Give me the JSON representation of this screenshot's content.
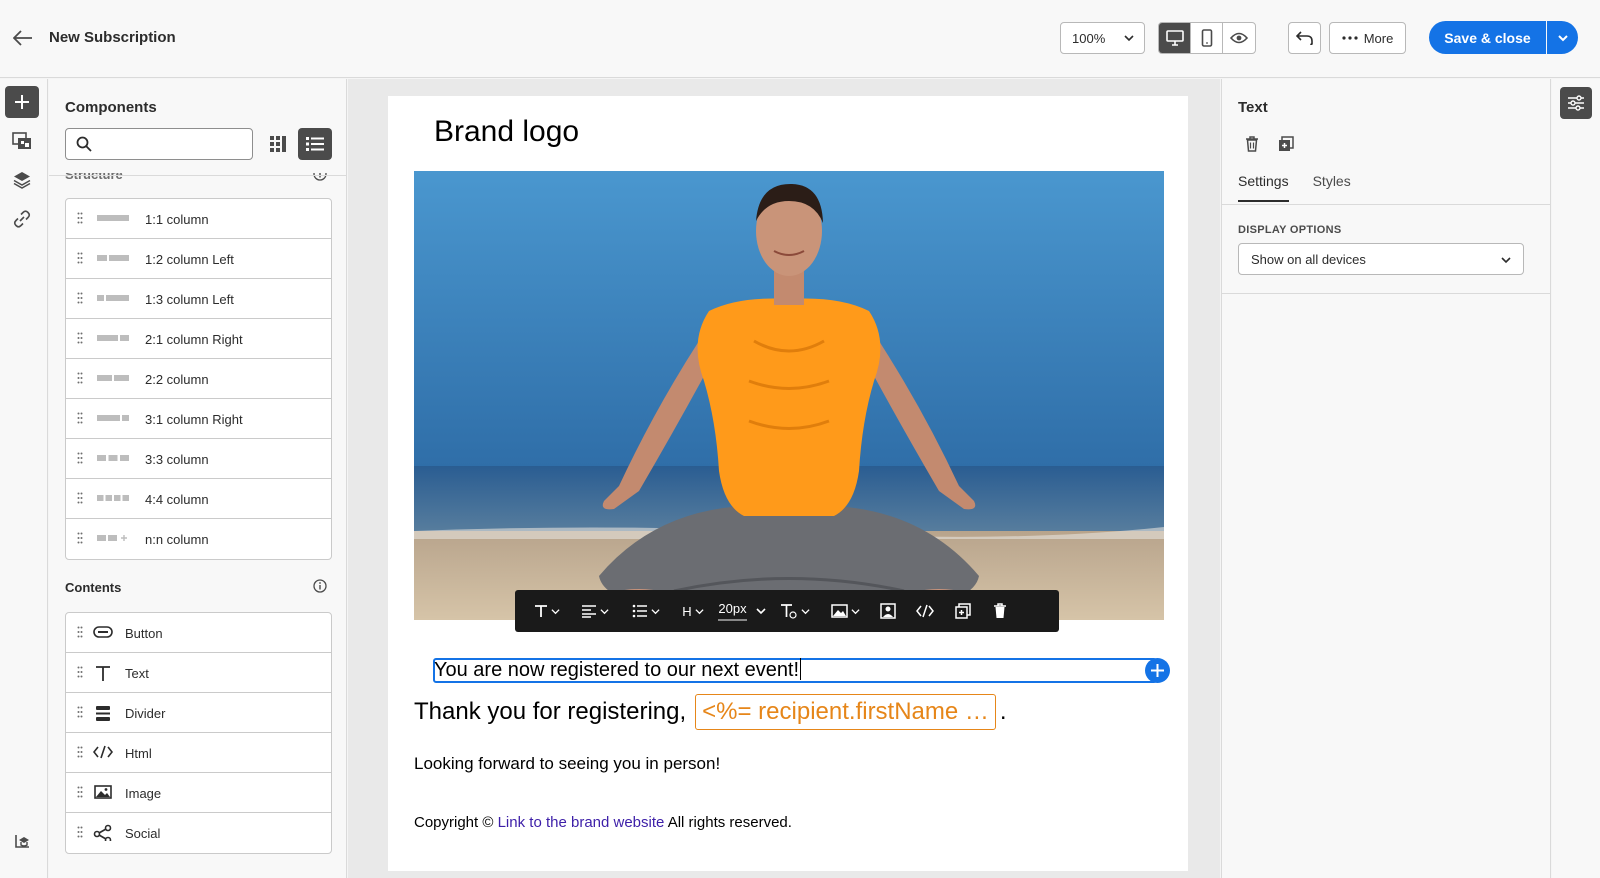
{
  "header": {
    "title": "New Subscription",
    "zoom": "100%",
    "more_label": "More",
    "save_label": "Save & close"
  },
  "components": {
    "title": "Components",
    "search_placeholder": "",
    "structure_heading": "Structure",
    "structures": [
      {
        "label": "1:1 column",
        "icon": "1-col-icon"
      },
      {
        "label": "1:2 column Left",
        "icon": "1-2-col-icon"
      },
      {
        "label": "1:3 column Left",
        "icon": "1-3-col-icon"
      },
      {
        "label": "2:1 column Right",
        "icon": "2-1-col-icon"
      },
      {
        "label": "2:2 column",
        "icon": "2-2-col-icon"
      },
      {
        "label": "3:1 column Right",
        "icon": "3-1-col-icon"
      },
      {
        "label": "3:3 column",
        "icon": "3-3-col-icon"
      },
      {
        "label": "4:4 column",
        "icon": "4-4-col-icon"
      },
      {
        "label": "n:n column",
        "icon": "n-n-col-icon"
      }
    ],
    "contents_heading": "Contents",
    "contents": [
      {
        "label": "Button",
        "icon": "button-icon"
      },
      {
        "label": "Text",
        "icon": "text-icon"
      },
      {
        "label": "Divider",
        "icon": "divider-icon"
      },
      {
        "label": "Html",
        "icon": "html-icon"
      },
      {
        "label": "Image",
        "icon": "image-icon"
      },
      {
        "label": "Social",
        "icon": "social-icon"
      }
    ]
  },
  "email": {
    "brand": "Brand logo",
    "selected_text": "You are now registered to our next event!",
    "thanks": "Thank you for registering,",
    "personalization": "<%= recipient.firstName …",
    "period": ".",
    "forward": "Looking forward to seeing you in person!",
    "copyright_prefix": "Copyright ©",
    "copyright_link": "Link to the brand website",
    "copyright_suffix": "All rights reserved."
  },
  "toolbar": {
    "heading": "H",
    "font_size": "20px"
  },
  "properties": {
    "title": "Text",
    "tabs": [
      "Settings",
      "Styles"
    ],
    "display_options_label": "DISPLAY OPTIONS",
    "display_options_value": "Show on all devices"
  },
  "colors": {
    "accent": "#1473e6",
    "personalization": "#e68619",
    "link": "#3d1fa8"
  }
}
